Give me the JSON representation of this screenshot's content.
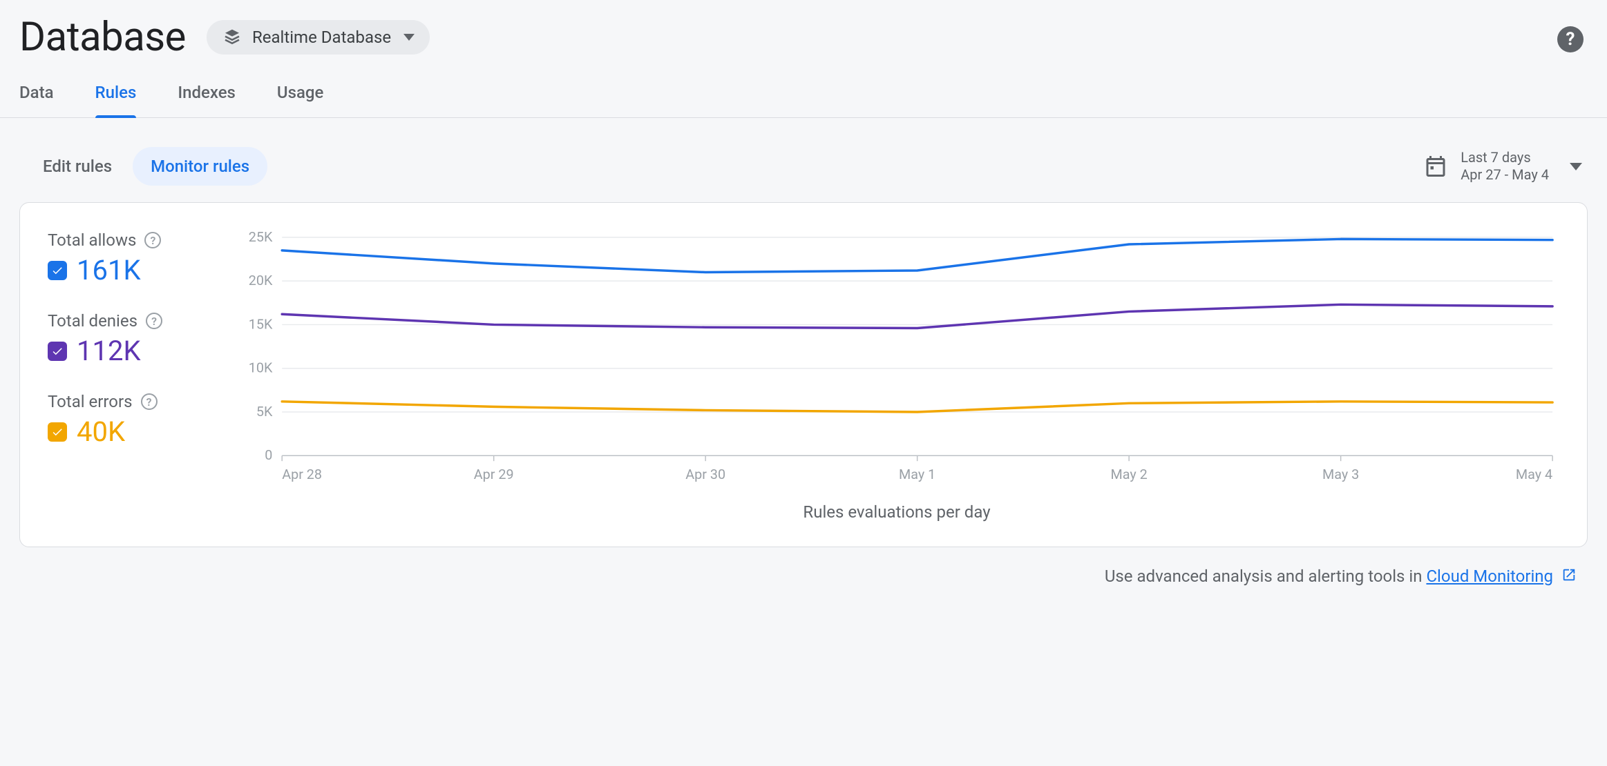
{
  "header": {
    "title": "Database",
    "db_selector_label": "Realtime Database",
    "help_tooltip": "?"
  },
  "tabs": [
    {
      "label": "Data",
      "active": false
    },
    {
      "label": "Rules",
      "active": true
    },
    {
      "label": "Indexes",
      "active": false
    },
    {
      "label": "Usage",
      "active": false
    }
  ],
  "subtabs": [
    {
      "label": "Edit rules",
      "active": false
    },
    {
      "label": "Monitor rules",
      "active": true
    }
  ],
  "date_picker": {
    "label": "Last 7 days",
    "range": "Apr 27 - May 4"
  },
  "legend": {
    "allows": {
      "label": "Total allows",
      "value": "161K",
      "color": "#1a73e8"
    },
    "denies": {
      "label": "Total denies",
      "value": "112K",
      "color": "#5e35b1"
    },
    "errors": {
      "label": "Total errors",
      "value": "40K",
      "color": "#f2a600"
    }
  },
  "chart_data": {
    "type": "line",
    "title": "",
    "xlabel": "Rules evaluations per day",
    "ylabel": "",
    "ylim": [
      0,
      25000
    ],
    "y_ticks": [
      "0",
      "5K",
      "10K",
      "15K",
      "20K",
      "25K"
    ],
    "categories": [
      "Apr 28",
      "Apr 29",
      "Apr 30",
      "May 1",
      "May 2",
      "May 3",
      "May 4"
    ],
    "series": [
      {
        "name": "Total allows",
        "color": "#1a73e8",
        "values": [
          23500,
          22000,
          21000,
          21200,
          24200,
          24800,
          24700
        ]
      },
      {
        "name": "Total denies",
        "color": "#5e35b1",
        "values": [
          16200,
          15000,
          14700,
          14600,
          16500,
          17300,
          17100
        ]
      },
      {
        "name": "Total errors",
        "color": "#f2a600",
        "values": [
          6200,
          5600,
          5200,
          5000,
          6000,
          6200,
          6100
        ]
      }
    ]
  },
  "footer": {
    "text_prefix": "Use advanced analysis and alerting tools in ",
    "link_text": "Cloud Monitoring"
  }
}
